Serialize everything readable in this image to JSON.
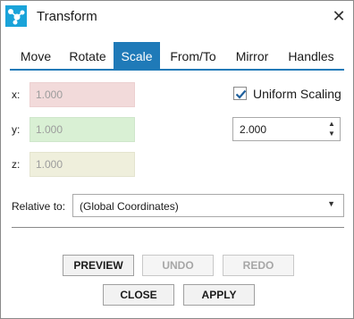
{
  "window": {
    "title": "Transform",
    "app_icon": "molecule-icon",
    "close_icon": "close-icon"
  },
  "tabs": [
    {
      "label": "Move",
      "active": false
    },
    {
      "label": "Rotate",
      "active": false
    },
    {
      "label": "Scale",
      "active": true
    },
    {
      "label": "From/To",
      "active": false
    },
    {
      "label": "Mirror",
      "active": false
    },
    {
      "label": "Handles",
      "active": false
    }
  ],
  "scale": {
    "x": {
      "label": "x:",
      "value": "1.000",
      "color": "#f2dada"
    },
    "y": {
      "label": "y:",
      "value": "1.000",
      "color": "#d9f0d4"
    },
    "z": {
      "label": "z:",
      "value": "1.000",
      "color": "#efefdc"
    },
    "uniform_scaling": {
      "label": "Uniform Scaling",
      "checked": true
    },
    "uniform_value": "2.000"
  },
  "relative_to": {
    "label": "Relative to:",
    "selected": "(Global Coordinates)"
  },
  "buttons": {
    "preview": "PREVIEW",
    "undo": "UNDO",
    "redo": "REDO",
    "close": "CLOSE",
    "apply": "APPLY"
  },
  "colors": {
    "accent": "#1f7ab8",
    "checkmark": "#1f5f9c"
  }
}
